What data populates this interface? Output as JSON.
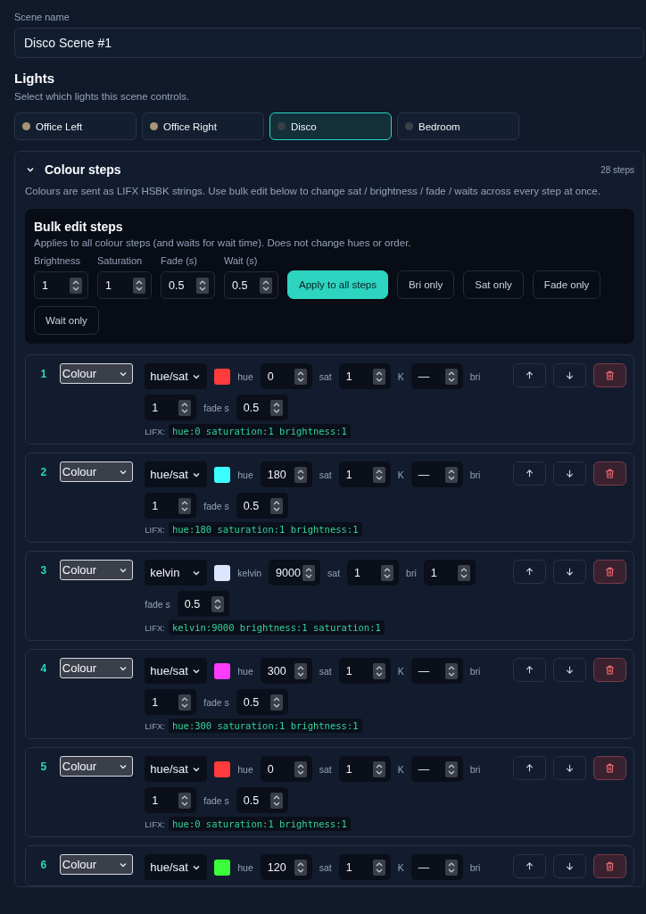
{
  "scene_name": {
    "label": "Scene name",
    "value": "Disco Scene #1"
  },
  "lights": {
    "title": "Lights",
    "subtitle": "Select which lights this scene controls.",
    "items": [
      {
        "label": "Office Left",
        "selected": false,
        "color": "#a89478"
      },
      {
        "label": "Office Right",
        "selected": false,
        "color": "#a89478"
      },
      {
        "label": "Disco",
        "selected": true,
        "color": "#3b3f46"
      },
      {
        "label": "Bedroom",
        "selected": false,
        "color": "#3b3f46"
      }
    ]
  },
  "colour_steps": {
    "title": "Colour steps",
    "expanded": true,
    "count": "28 steps",
    "description": "Colours are sent as LIFX HSBK strings. Use bulk edit below to change sat / brightness / fade / waits across every step at once.",
    "bulk_edit": {
      "title": "Bulk edit steps",
      "description": "Applies to all colour steps (and waits for wait time). Does not change hues or order.",
      "fields": [
        {
          "label": "Brightness",
          "value": "1"
        },
        {
          "label": "Saturation",
          "value": "1"
        },
        {
          "label": "Fade (s)",
          "value": "0.5"
        },
        {
          "label": "Wait (s)",
          "value": "0.5"
        }
      ],
      "buttons": [
        {
          "label": "Apply to all steps",
          "kind": "primary"
        },
        {
          "label": "Bri only",
          "kind": "outline"
        },
        {
          "label": "Sat only",
          "kind": "outline"
        },
        {
          "label": "Fade only",
          "kind": "outline"
        },
        {
          "label": "Wait only",
          "kind": "outline"
        }
      ]
    },
    "steps": [
      {
        "number": "1",
        "type": "Colour",
        "mode": "hue/sat",
        "color": "#ff3b3b",
        "fields": [
          {
            "label": "hue",
            "value": "0"
          },
          {
            "label": "sat",
            "value": "1"
          },
          {
            "label": "K",
            "value": "—"
          },
          {
            "label": "bri",
            "value": "1"
          },
          {
            "label": "fade s",
            "value": "0.5"
          }
        ],
        "lifx_label": "LIFX:",
        "lifx": "hue:0 saturation:1 brightness:1"
      },
      {
        "number": "2",
        "type": "Colour",
        "mode": "hue/sat",
        "color": "#3bffff",
        "fields": [
          {
            "label": "hue",
            "value": "180"
          },
          {
            "label": "sat",
            "value": "1"
          },
          {
            "label": "K",
            "value": "—"
          },
          {
            "label": "bri",
            "value": "1"
          },
          {
            "label": "fade s",
            "value": "0.5"
          }
        ],
        "lifx_label": "LIFX:",
        "lifx": "hue:180 saturation:1 brightness:1"
      },
      {
        "number": "3",
        "type": "Colour",
        "mode": "kelvin",
        "color": "#dce6ff",
        "fields": [
          {
            "label": "kelvin",
            "value": "9000"
          },
          {
            "label": "sat",
            "value": "1"
          },
          {
            "label": "bri",
            "value": "1"
          },
          {
            "label": "fade s",
            "value": "0.5"
          }
        ],
        "lifx_label": "LIFX:",
        "lifx": "kelvin:9000 brightness:1 saturation:1"
      },
      {
        "number": "4",
        "type": "Colour",
        "mode": "hue/sat",
        "color": "#ff3bff",
        "fields": [
          {
            "label": "hue",
            "value": "300"
          },
          {
            "label": "sat",
            "value": "1"
          },
          {
            "label": "K",
            "value": "—"
          },
          {
            "label": "bri",
            "value": "1"
          },
          {
            "label": "fade s",
            "value": "0.5"
          }
        ],
        "lifx_label": "LIFX:",
        "lifx": "hue:300 saturation:1 brightness:1"
      },
      {
        "number": "5",
        "type": "Colour",
        "mode": "hue/sat",
        "color": "#ff3b3b",
        "fields": [
          {
            "label": "hue",
            "value": "0"
          },
          {
            "label": "sat",
            "value": "1"
          },
          {
            "label": "K",
            "value": "—"
          },
          {
            "label": "bri",
            "value": "1"
          },
          {
            "label": "fade s",
            "value": "0.5"
          }
        ],
        "lifx_label": "LIFX:",
        "lifx": "hue:0 saturation:1 brightness:1"
      },
      {
        "number": "6",
        "type": "Colour",
        "mode": "hue/sat",
        "color": "#3bff3b",
        "fields": [
          {
            "label": "hue",
            "value": "120"
          },
          {
            "label": "sat",
            "value": "1"
          },
          {
            "label": "K",
            "value": "—"
          },
          {
            "label": "bri"
          }
        ]
      }
    ]
  }
}
